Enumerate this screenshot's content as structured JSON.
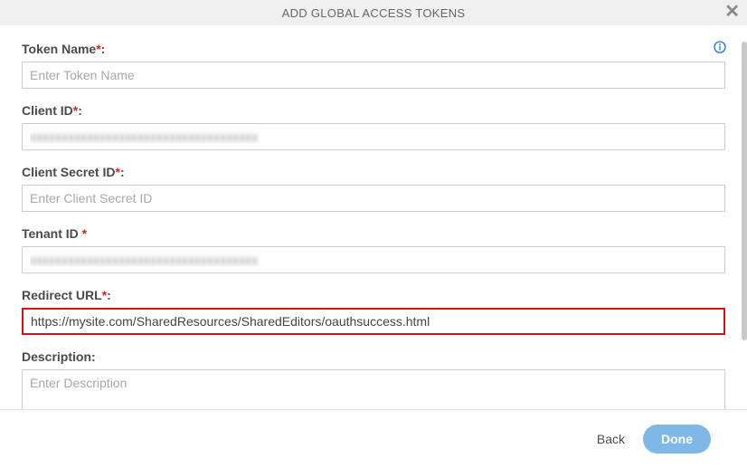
{
  "header": {
    "title": "ADD GLOBAL ACCESS TOKENS"
  },
  "fields": {
    "tokenName": {
      "label": "Token Name",
      "placeholder": "Enter Token Name",
      "value": ""
    },
    "clientId": {
      "label": "Client ID",
      "placeholder": "",
      "value": "xxxxxxxxxxxxxxxxxxxxxxxxxxxxxxxxxxxx"
    },
    "clientSecretId": {
      "label": "Client Secret ID",
      "placeholder": "Enter Client Secret ID",
      "value": ""
    },
    "tenantId": {
      "label": "Tenant ID",
      "placeholder": "",
      "value": "xxxxxxxxxxxxxxxxxxxxxxxxxxxxxxxxxxxx"
    },
    "redirectUrl": {
      "label": "Redirect URL",
      "placeholder": "",
      "value": "https://mysite.com/SharedResources/SharedEditors/oauthsuccess.html"
    },
    "description": {
      "label": "Description",
      "placeholder": "Enter Description",
      "value": ""
    }
  },
  "footer": {
    "back": "Back",
    "done": "Done"
  }
}
